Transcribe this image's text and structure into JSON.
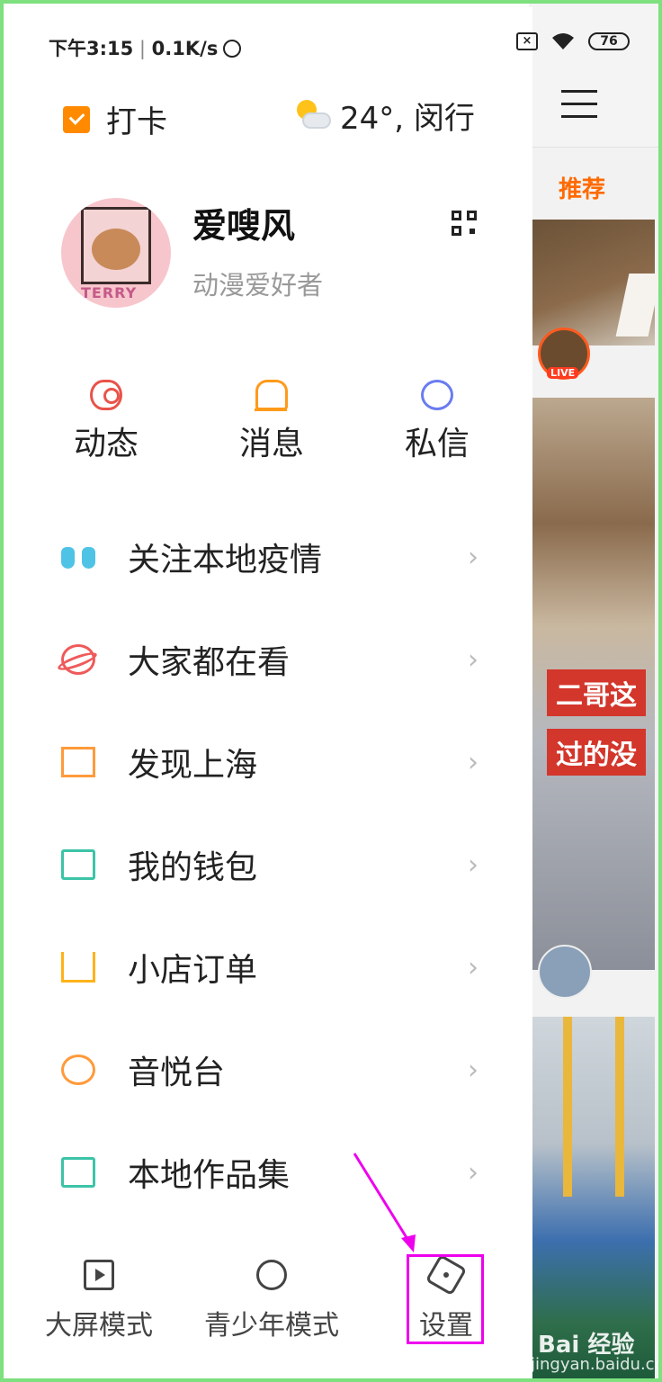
{
  "status_bar": {
    "time": "下午3:15",
    "speed": "0.1K/s",
    "battery": "76"
  },
  "header": {
    "checkin_label": "打卡",
    "weather": "24°, 闵行"
  },
  "profile": {
    "name": "爱嗖风",
    "bio": "动漫爱好者",
    "avatar_text": "TERRY"
  },
  "quick_actions": [
    {
      "label": "动态",
      "icon": "eye-icon"
    },
    {
      "label": "消息",
      "icon": "bell-icon"
    },
    {
      "label": "私信",
      "icon": "chat-bubble-icon"
    }
  ],
  "menu": [
    {
      "label": "关注本地疫情",
      "icon": "lungs-icon"
    },
    {
      "label": "大家都在看",
      "icon": "planet-icon"
    },
    {
      "label": "发现上海",
      "icon": "building-icon"
    },
    {
      "label": "我的钱包",
      "icon": "wallet-icon"
    },
    {
      "label": "小店订单",
      "icon": "cart-icon"
    },
    {
      "label": "音悦台",
      "icon": "music-disc-icon"
    },
    {
      "label": "本地作品集",
      "icon": "folder-icon"
    }
  ],
  "bottom_bar": [
    {
      "label": "大屏模式",
      "icon": "play-screen-icon"
    },
    {
      "label": "青少年模式",
      "icon": "child-face-icon"
    },
    {
      "label": "设置",
      "icon": "settings-hexagon-icon"
    }
  ],
  "background_feed": {
    "tab": "推荐",
    "live_badge": "LIVE",
    "caption_line1": "二哥这",
    "caption_line2": "过的没",
    "watermark": "Bai 经验",
    "watermark_url": "jingyan.baidu.com"
  },
  "colors": {
    "accent_orange": "#ff6a00",
    "annotation_magenta": "#ee00ee",
    "frame_green": "#7ee07e"
  }
}
